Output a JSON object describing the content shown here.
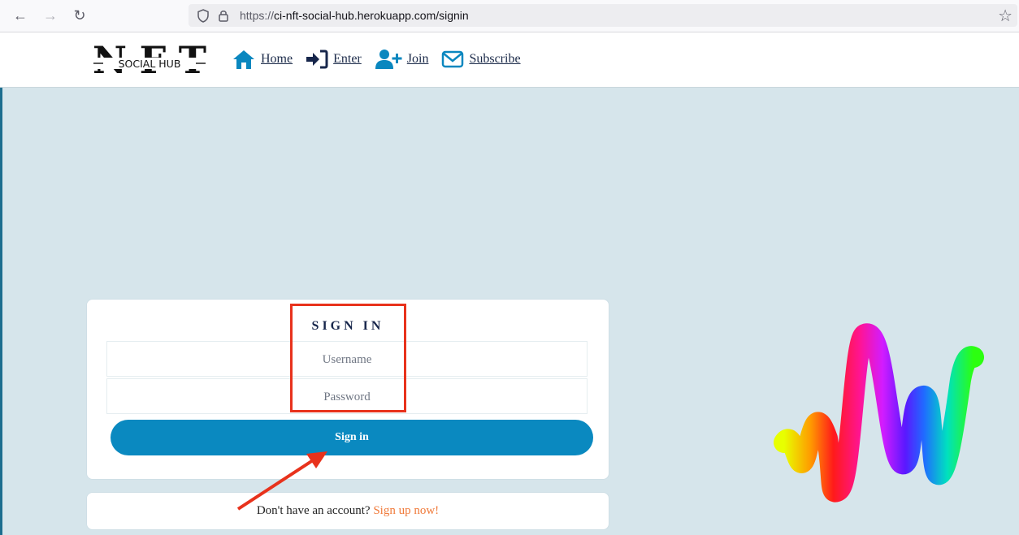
{
  "browser": {
    "url_proto": "https://",
    "url_rest": "ci-nft-social-hub.herokuapp.com/signin"
  },
  "logo": {
    "top": "NFT",
    "bottom": "SOCIAL HUB"
  },
  "nav": [
    {
      "label": "Home",
      "icon": "home-icon"
    },
    {
      "label": "Enter",
      "icon": "sign-in-icon"
    },
    {
      "label": "Join",
      "icon": "user-plus-icon"
    },
    {
      "label": "Subscribe",
      "icon": "envelope-icon"
    }
  ],
  "signin": {
    "title": "SIGN IN",
    "username_placeholder": "Username",
    "password_placeholder": "Password",
    "button": "Sign in"
  },
  "signup": {
    "prompt": "Don't have an account?",
    "link": "Sign up now!"
  },
  "colors": {
    "button": "#0a89c0",
    "link": "#f07a3a",
    "annotation": "#e8321c",
    "background": "#d6e5eb"
  }
}
